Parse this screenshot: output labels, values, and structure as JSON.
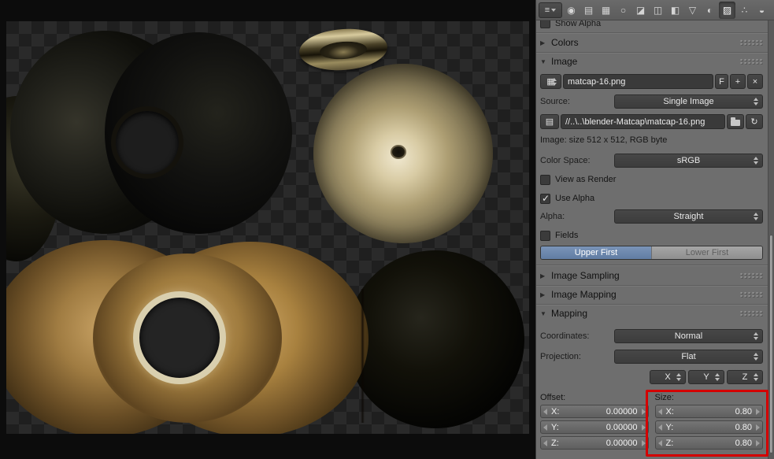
{
  "viewport": {
    "background_checker": [
      "#1f1f1f",
      "#2a2a2a"
    ],
    "matcap_gold": "#c9a76a",
    "matcap_dark": "#0a0a08"
  },
  "header": {
    "editor_glyph": "≡",
    "tabs": [
      {
        "name": "render",
        "glyph": "◉"
      },
      {
        "name": "render-layers",
        "glyph": "▤"
      },
      {
        "name": "scene",
        "glyph": "▦"
      },
      {
        "name": "world",
        "glyph": "○"
      },
      {
        "name": "object",
        "glyph": "◪"
      },
      {
        "name": "constraints",
        "glyph": "◫"
      },
      {
        "name": "modifiers",
        "glyph": "◧"
      },
      {
        "name": "object-data",
        "glyph": "▽"
      },
      {
        "name": "material",
        "glyph": "◐"
      },
      {
        "name": "texture",
        "glyph": "▨",
        "active": true
      },
      {
        "name": "particles",
        "glyph": "∴"
      },
      {
        "name": "physics",
        "glyph": "◒"
      }
    ]
  },
  "panels": {
    "preview_clipped": {
      "show_alpha_label": "Show Alpha"
    },
    "colors": {
      "title": "Colors"
    },
    "image": {
      "title": "Image",
      "browse_glyph": "▦",
      "name_field": "matcap-16.png",
      "fake_user_label": "F",
      "copy_glyph": "+",
      "unlink_glyph": "×",
      "source_label": "Source:",
      "source_value": "Single Image",
      "file_icon_glyph": "▤",
      "filepath": "//..\\..\\blender-Matcap\\matcap-16.png",
      "reload_glyph": "↻",
      "info": "Image: size 512 x 512, RGB byte",
      "colorspace_label": "Color Space:",
      "colorspace_value": "sRGB",
      "view_as_render_label": "View as Render",
      "use_alpha_label": "Use Alpha",
      "alpha_label": "Alpha:",
      "alpha_value": "Straight",
      "fields_label": "Fields",
      "order_toggle": {
        "upper": "Upper First",
        "lower": "Lower First",
        "active": "Upper First"
      }
    },
    "image_sampling": {
      "title": "Image Sampling"
    },
    "image_mapping": {
      "title": "Image Mapping"
    },
    "mapping": {
      "title": "Mapping",
      "coordinates_label": "Coordinates:",
      "coordinates_value": "Normal",
      "projection_label": "Projection:",
      "projection_value": "Flat",
      "axes": [
        {
          "label": "X"
        },
        {
          "label": "Y"
        },
        {
          "label": "Z"
        }
      ],
      "offset_label": "Offset:",
      "size_label": "Size:",
      "offset_fields": [
        {
          "label": "X:",
          "value": "0.00000"
        },
        {
          "label": "Y:",
          "value": "0.00000"
        },
        {
          "label": "Z:",
          "value": "0.00000"
        }
      ],
      "size_fields": [
        {
          "label": "X:",
          "value": "0.80"
        },
        {
          "label": "Y:",
          "value": "0.80"
        },
        {
          "label": "Z:",
          "value": "0.80"
        }
      ]
    }
  },
  "annotation": {
    "highlight_color": "#d40000",
    "target": "Size fields"
  }
}
